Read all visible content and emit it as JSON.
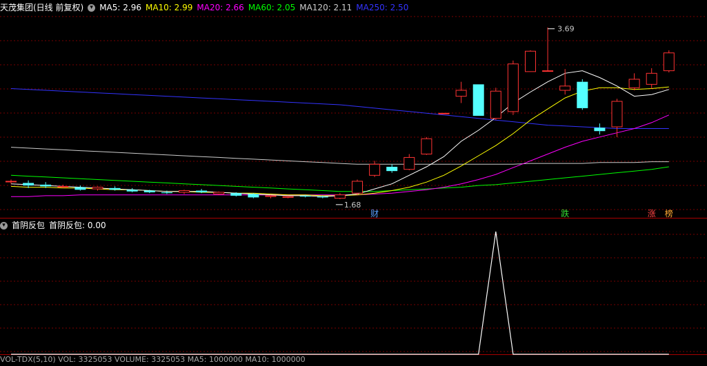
{
  "main_header": {
    "title": "天茂集团(日线 前复权)",
    "ma_items": [
      {
        "label": "MA5: 2.96",
        "color": "#ffffff"
      },
      {
        "label": "MA10: 2.99",
        "color": "#ffff00"
      },
      {
        "label": "MA20: 2.66",
        "color": "#ff00ff"
      },
      {
        "label": "MA60: 2.05",
        "color": "#00ff00"
      },
      {
        "label": "MA120: 2.11",
        "color": "#cccccc"
      },
      {
        "label": "MA250: 2.50",
        "color": "#3333ff"
      }
    ]
  },
  "sub_header": {
    "title": "首阴反包",
    "value_label": "首阴反包: 0.00"
  },
  "bottom_header": {
    "text": "VOL-TDX(5,10) VOL: 3325053 VOLUME: 3325053 MA5: 1000000 MA10: 1000000"
  },
  "annotations": {
    "high_price": "3.69",
    "low_price": "1.68",
    "markers": [
      {
        "label": "财",
        "color": "#5aa0ff",
        "index": 21
      },
      {
        "label": "跌",
        "color": "#33dd33",
        "index": 32
      },
      {
        "label": "涨",
        "color": "#ff4444",
        "index": 37
      },
      {
        "label": "榜",
        "color": "#ffaa33",
        "index": 38
      }
    ]
  },
  "colors": {
    "up": "#ff3333",
    "down": "#54ffff",
    "grid": "#7a0000",
    "indicator": "#ffffff"
  },
  "chart_data": {
    "type": "candlestick",
    "price_range": [
      1.45,
      3.85
    ],
    "candles": [
      {
        "o": 1.88,
        "h": 1.9,
        "l": 1.85,
        "c": 1.88
      },
      {
        "o": 1.86,
        "h": 1.89,
        "l": 1.8,
        "c": 1.83
      },
      {
        "o": 1.84,
        "h": 1.87,
        "l": 1.8,
        "c": 1.82
      },
      {
        "o": 1.82,
        "h": 1.84,
        "l": 1.8,
        "c": 1.82
      },
      {
        "o": 1.81,
        "h": 1.83,
        "l": 1.77,
        "c": 1.78
      },
      {
        "o": 1.79,
        "h": 1.82,
        "l": 1.77,
        "c": 1.81
      },
      {
        "o": 1.8,
        "h": 1.82,
        "l": 1.77,
        "c": 1.78
      },
      {
        "o": 1.78,
        "h": 1.8,
        "l": 1.75,
        "c": 1.76
      },
      {
        "o": 1.77,
        "h": 1.78,
        "l": 1.74,
        "c": 1.75
      },
      {
        "o": 1.75,
        "h": 1.77,
        "l": 1.73,
        "c": 1.74
      },
      {
        "o": 1.75,
        "h": 1.78,
        "l": 1.73,
        "c": 1.77
      },
      {
        "o": 1.77,
        "h": 1.79,
        "l": 1.74,
        "c": 1.75
      },
      {
        "o": 1.73,
        "h": 1.76,
        "l": 1.72,
        "c": 1.75
      },
      {
        "o": 1.74,
        "h": 1.75,
        "l": 1.7,
        "c": 1.71
      },
      {
        "o": 1.73,
        "h": 1.74,
        "l": 1.68,
        "c": 1.69
      },
      {
        "o": 1.7,
        "h": 1.72,
        "l": 1.68,
        "c": 1.71
      },
      {
        "o": 1.69,
        "h": 1.71,
        "l": 1.68,
        "c": 1.7
      },
      {
        "o": 1.71,
        "h": 1.72,
        "l": 1.69,
        "c": 1.7
      },
      {
        "o": 1.7,
        "h": 1.71,
        "l": 1.68,
        "c": 1.69
      },
      {
        "o": 1.68,
        "h": 1.74,
        "l": 1.67,
        "c": 1.72
      },
      {
        "o": 1.74,
        "h": 1.9,
        "l": 1.72,
        "c": 1.88
      },
      {
        "o": 1.95,
        "h": 2.12,
        "l": 1.93,
        "c": 2.08
      },
      {
        "o": 2.05,
        "h": 2.08,
        "l": 1.98,
        "c": 2.0
      },
      {
        "o": 2.02,
        "h": 2.2,
        "l": 2.01,
        "c": 2.16
      },
      {
        "o": 2.2,
        "h": 2.4,
        "l": 2.19,
        "c": 2.38
      },
      {
        "o": 2.68,
        "h": 2.68,
        "l": 2.67,
        "c": 2.68
      },
      {
        "o": 2.88,
        "h": 3.05,
        "l": 2.8,
        "c": 2.95
      },
      {
        "o": 3.02,
        "h": 3.02,
        "l": 2.65,
        "c": 2.65
      },
      {
        "o": 2.62,
        "h": 2.98,
        "l": 2.6,
        "c": 2.94
      },
      {
        "o": 2.7,
        "h": 3.3,
        "l": 2.66,
        "c": 3.26
      },
      {
        "o": 3.17,
        "h": 3.42,
        "l": 3.17,
        "c": 3.41
      },
      {
        "o": 3.18,
        "h": 3.69,
        "l": 3.17,
        "c": 3.18
      },
      {
        "o": 2.95,
        "h": 3.2,
        "l": 2.9,
        "c": 3.0
      },
      {
        "o": 3.05,
        "h": 3.08,
        "l": 2.72,
        "c": 2.74
      },
      {
        "o": 2.51,
        "h": 2.56,
        "l": 2.43,
        "c": 2.47
      },
      {
        "o": 2.52,
        "h": 2.85,
        "l": 2.4,
        "c": 2.82
      },
      {
        "o": 2.98,
        "h": 3.15,
        "l": 2.95,
        "c": 3.08
      },
      {
        "o": 3.02,
        "h": 3.21,
        "l": 2.97,
        "c": 3.15
      },
      {
        "o": 3.18,
        "h": 3.42,
        "l": 3.16,
        "c": 3.39
      }
    ],
    "ma5": [
      1.85,
      1.84,
      1.83,
      1.82,
      1.81,
      1.8,
      1.79,
      1.78,
      1.77,
      1.76,
      1.76,
      1.76,
      1.75,
      1.74,
      1.73,
      1.72,
      1.71,
      1.71,
      1.7,
      1.71,
      1.73,
      1.79,
      1.85,
      1.95,
      2.05,
      2.17,
      2.35,
      2.48,
      2.63,
      2.8,
      2.93,
      3.05,
      3.15,
      3.18,
      3.1,
      3.0,
      2.88,
      2.9,
      2.96
    ],
    "ma10": [
      1.82,
      1.81,
      1.81,
      1.8,
      1.8,
      1.79,
      1.78,
      1.78,
      1.77,
      1.76,
      1.76,
      1.75,
      1.75,
      1.74,
      1.74,
      1.73,
      1.72,
      1.72,
      1.71,
      1.71,
      1.72,
      1.74,
      1.77,
      1.81,
      1.87,
      1.95,
      2.06,
      2.18,
      2.3,
      2.44,
      2.6,
      2.73,
      2.86,
      2.94,
      2.98,
      2.98,
      2.96,
      2.97,
      2.99
    ],
    "ma20": [
      1.7,
      1.7,
      1.71,
      1.71,
      1.72,
      1.72,
      1.72,
      1.72,
      1.72,
      1.72,
      1.72,
      1.72,
      1.72,
      1.72,
      1.72,
      1.72,
      1.72,
      1.72,
      1.72,
      1.72,
      1.72,
      1.73,
      1.74,
      1.76,
      1.78,
      1.81,
      1.85,
      1.9,
      1.96,
      2.04,
      2.12,
      2.2,
      2.28,
      2.35,
      2.4,
      2.45,
      2.5,
      2.57,
      2.66
    ],
    "ma60": [
      1.95,
      1.94,
      1.93,
      1.92,
      1.91,
      1.9,
      1.89,
      1.88,
      1.87,
      1.86,
      1.85,
      1.84,
      1.83,
      1.82,
      1.81,
      1.8,
      1.79,
      1.78,
      1.77,
      1.76,
      1.76,
      1.76,
      1.77,
      1.78,
      1.79,
      1.8,
      1.81,
      1.83,
      1.84,
      1.86,
      1.88,
      1.9,
      1.92,
      1.94,
      1.96,
      1.98,
      2.0,
      2.02,
      2.05
    ],
    "ma120": [
      2.28,
      2.27,
      2.26,
      2.25,
      2.24,
      2.23,
      2.22,
      2.21,
      2.2,
      2.19,
      2.18,
      2.17,
      2.16,
      2.15,
      2.14,
      2.13,
      2.12,
      2.11,
      2.1,
      2.09,
      2.08,
      2.08,
      2.08,
      2.08,
      2.08,
      2.08,
      2.08,
      2.08,
      2.08,
      2.08,
      2.09,
      2.09,
      2.09,
      2.09,
      2.1,
      2.1,
      2.1,
      2.11,
      2.11
    ],
    "ma250": [
      2.97,
      2.96,
      2.95,
      2.94,
      2.93,
      2.92,
      2.91,
      2.9,
      2.89,
      2.88,
      2.87,
      2.86,
      2.85,
      2.84,
      2.83,
      2.82,
      2.81,
      2.8,
      2.79,
      2.78,
      2.76,
      2.74,
      2.72,
      2.7,
      2.68,
      2.66,
      2.64,
      2.62,
      2.6,
      2.58,
      2.56,
      2.54,
      2.53,
      2.52,
      2.51,
      2.5,
      2.5,
      2.5,
      2.5
    ],
    "indicator": [
      0,
      0,
      0,
      0,
      0,
      0,
      0,
      0,
      0,
      0,
      0,
      0,
      0,
      0,
      0,
      0,
      0,
      0,
      0,
      0,
      0,
      0,
      0,
      0,
      0,
      0,
      0,
      0,
      1,
      0,
      0,
      0,
      0,
      0,
      0,
      0,
      0,
      0,
      0
    ],
    "indicator_range": [
      0,
      1
    ]
  }
}
